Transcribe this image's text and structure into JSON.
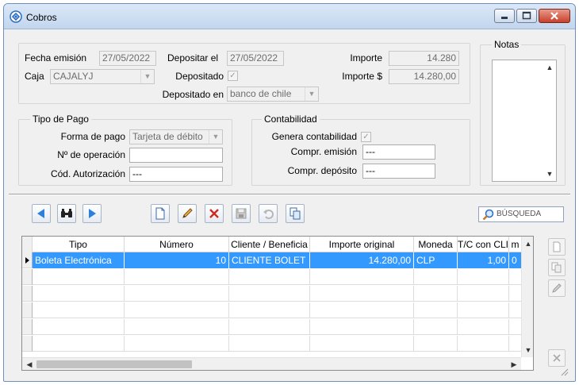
{
  "window": {
    "title": "Cobros"
  },
  "colors": {
    "selection": "#3399ff",
    "titlebar": "#c8daf0",
    "close_button": "#c8402c"
  },
  "form": {
    "fecha_emision_label": "Fecha emisión",
    "fecha_emision_value": "27/05/2022",
    "depositar_el_label": "Depositar el",
    "depositar_el_value": "27/05/2022",
    "caja_label": "Caja",
    "caja_value": "CAJALYJ",
    "depositado_label": "Depositado",
    "depositado_checked": true,
    "depositado_en_label": "Depositado en",
    "depositado_en_value": "banco de chile",
    "importe_label": "Importe",
    "importe_value": "14.280",
    "importe_usd_label": "Importe $",
    "importe_usd_value": "14.280,00"
  },
  "notas": {
    "legend": "Notas"
  },
  "tipo_pago": {
    "legend": "Tipo de Pago",
    "forma_pago_label": "Forma de pago",
    "forma_pago_value": "Tarjeta de débito",
    "n_operacion_label": "Nº de operación",
    "n_operacion_value": "",
    "cod_autorizacion_label": "Cód. Autorización",
    "cod_autorizacion_value": "---"
  },
  "contabilidad": {
    "legend": "Contabilidad",
    "genera_label": "Genera contabilidad",
    "genera_checked": true,
    "compr_emision_label": "Compr. emisión",
    "compr_emision_value": "---",
    "compr_deposito_label": "Compr. depósito",
    "compr_deposito_value": "---"
  },
  "toolbar": {
    "search_label": "BÚSQUEDA",
    "icons": [
      "prev-icon",
      "binoculars-icon",
      "next-icon",
      "new-document-icon",
      "edit-pencil-icon",
      "delete-x-icon",
      "save-disk-icon",
      "undo-icon",
      "copy-icon"
    ]
  },
  "grid": {
    "columns": [
      "Tipo",
      "Número",
      "Cliente / Beneficia",
      "Importe original",
      "Moneda",
      "T/C con CLI",
      "m"
    ],
    "rows": [
      {
        "tipo": "Boleta Electrónica",
        "numero": "10",
        "cliente": "CLIENTE BOLET",
        "importe": "14.280,00",
        "moneda": "CLP",
        "tc": "1,00",
        "extra": "0"
      }
    ]
  },
  "side_buttons": [
    "new-row-icon",
    "copy-row-icon",
    "edit-row-icon",
    "delete-row-icon"
  ]
}
